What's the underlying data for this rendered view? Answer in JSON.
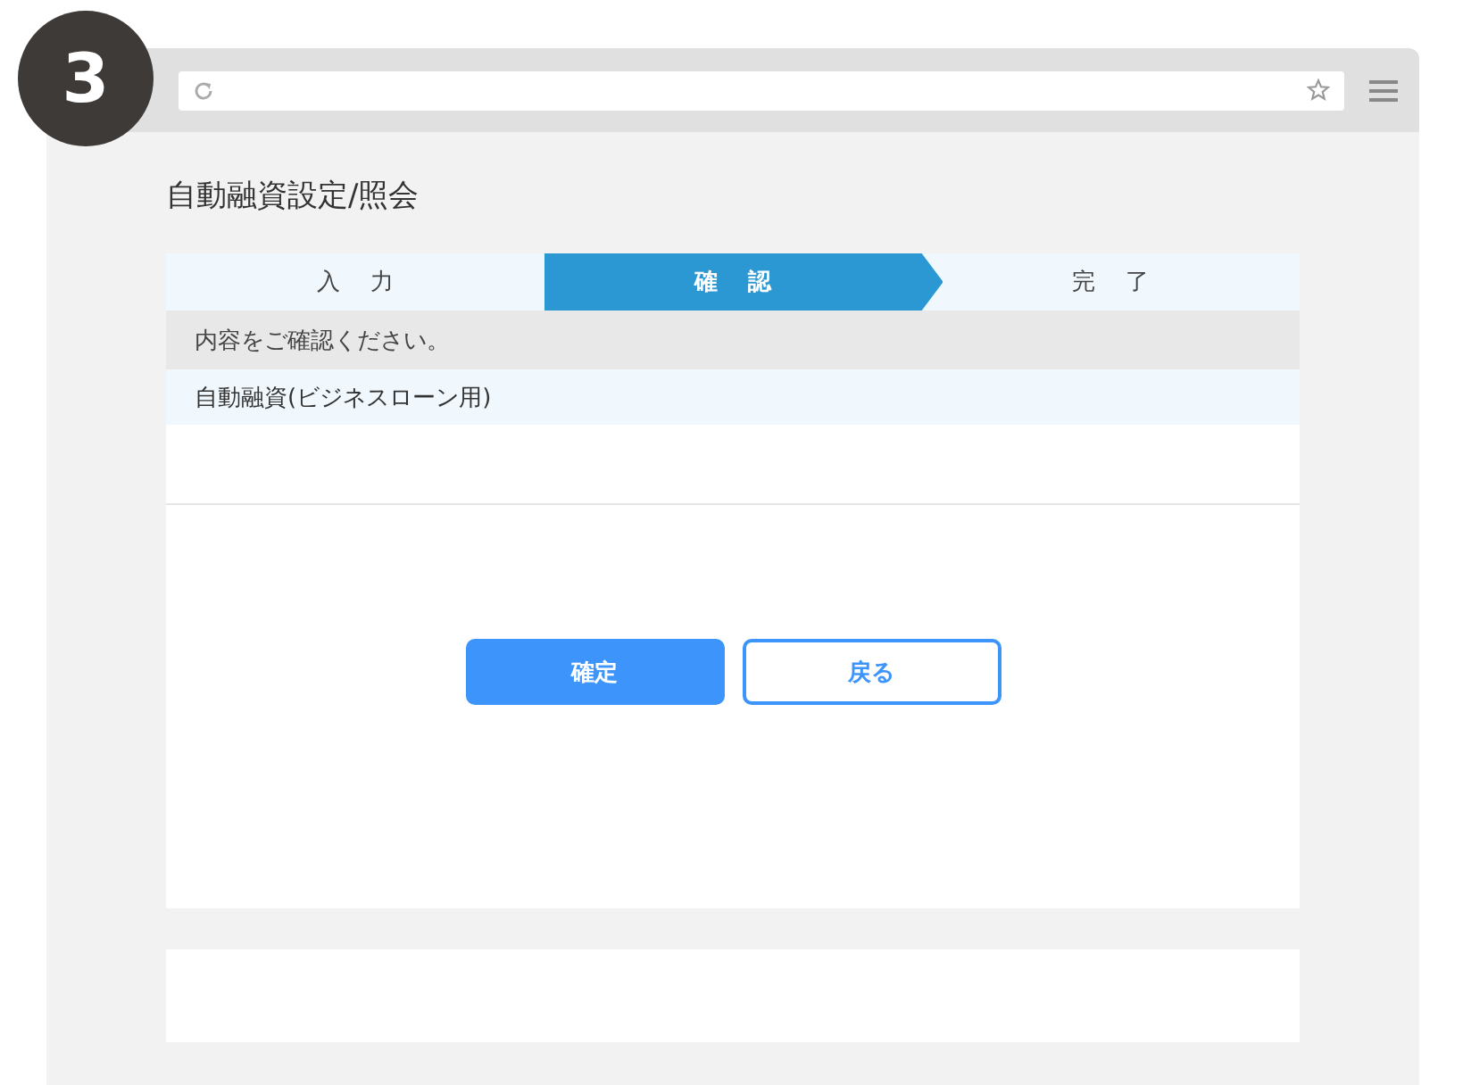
{
  "step_badge": "3",
  "page": {
    "title": "自動融資設定/照会"
  },
  "steps": [
    {
      "label": "入力",
      "selected": false
    },
    {
      "label": "確認",
      "selected": true
    },
    {
      "label": "完了",
      "selected": false
    }
  ],
  "message": "内容をご確認ください。",
  "item": "自動融資(ビジネスローン用)",
  "buttons": [
    {
      "label": "確定",
      "kind": "primary"
    },
    {
      "label": "戻る",
      "kind": "secondary"
    }
  ]
}
